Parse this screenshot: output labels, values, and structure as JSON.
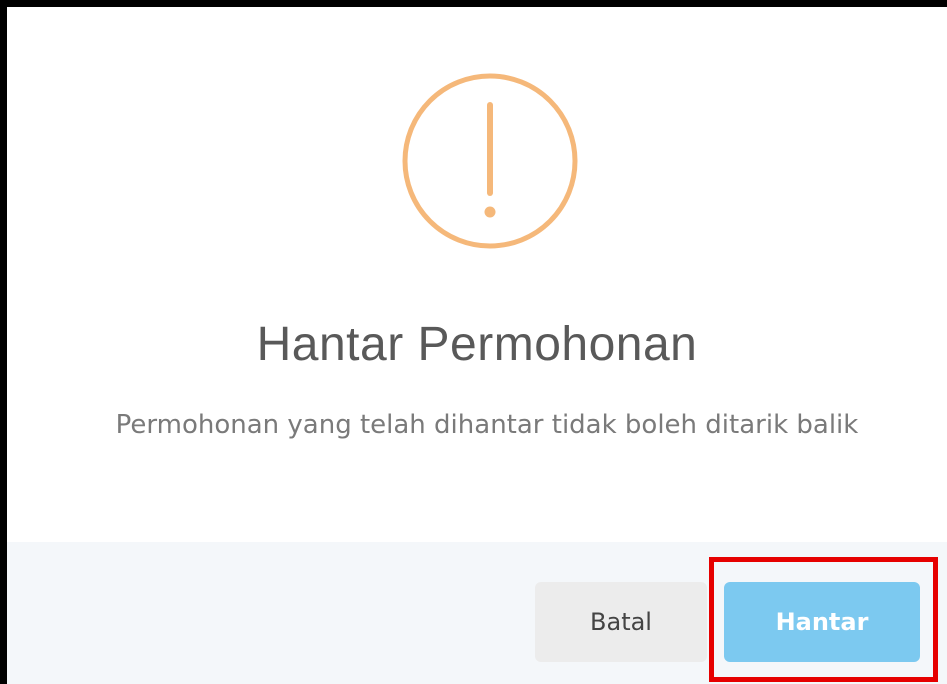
{
  "dialog": {
    "icon": "exclamation-circle-icon",
    "icon_color": "#f5b87a",
    "title": "Hantar Permohonan",
    "message": "Permohonan yang telah dihantar tidak boleh ditarik balik"
  },
  "footer": {
    "cancel_label": "Batal",
    "submit_label": "Hantar"
  },
  "colors": {
    "submit_button": "#7cc9f0",
    "cancel_button": "#ececec",
    "footer_background": "#f4f7fa",
    "highlight": "#e60000"
  }
}
